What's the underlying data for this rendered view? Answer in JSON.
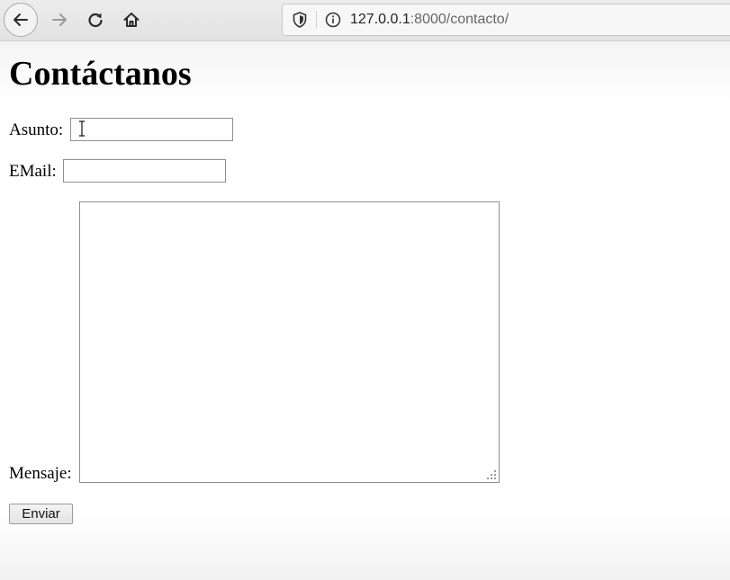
{
  "browser": {
    "url_host": "127.0.0.1",
    "url_rest": ":8000/contacto/",
    "icons": {
      "back": "back-arrow-icon",
      "forward": "forward-arrow-icon",
      "reload": "reload-icon",
      "home": "home-icon",
      "shield": "tracking-shield-icon",
      "info": "site-info-icon"
    }
  },
  "page": {
    "title": "Contáctanos",
    "form": {
      "asunto_label": "Asunto:",
      "asunto_value": "",
      "email_label": "EMail:",
      "email_value": "",
      "mensaje_label": "Mensaje:",
      "mensaje_value": "",
      "submit_label": "Enviar"
    }
  }
}
